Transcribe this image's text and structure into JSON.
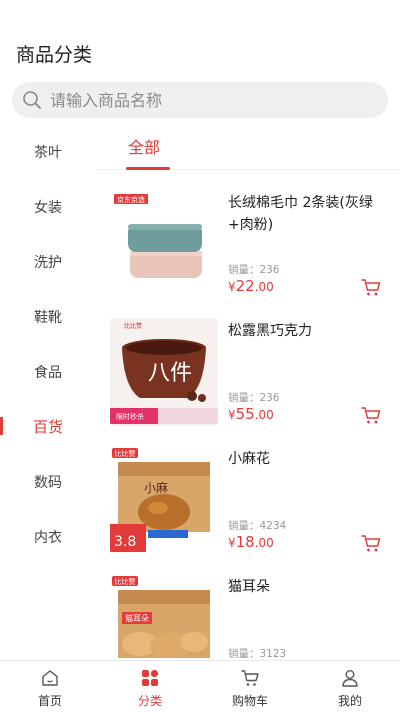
{
  "header": {
    "title": "商品分类"
  },
  "search": {
    "placeholder": "请输入商品名称",
    "icon": "search-icon"
  },
  "sidebar": {
    "items": [
      {
        "label": "茶叶",
        "active": false
      },
      {
        "label": "女装",
        "active": false
      },
      {
        "label": "洗护",
        "active": false
      },
      {
        "label": "鞋靴",
        "active": false
      },
      {
        "label": "食品",
        "active": false
      },
      {
        "label": "百货",
        "active": true
      },
      {
        "label": "数码",
        "active": false
      },
      {
        "label": "内衣",
        "active": false
      }
    ]
  },
  "tabs": {
    "active_label": "全部"
  },
  "products": [
    {
      "name": "长绒棉毛巾 2条装(灰绿+肉粉)",
      "sales": "销量：236",
      "currency": "¥",
      "price_int": "22",
      "price_dec": ".00"
    },
    {
      "name": "松露黑巧克力",
      "sales": "销量：236",
      "currency": "¥",
      "price_int": "55",
      "price_dec": ".00"
    },
    {
      "name": "小麻花",
      "sales": "销量：4234",
      "currency": "¥",
      "price_int": "18",
      "price_dec": ".00"
    },
    {
      "name": "猫耳朵",
      "sales": "销量：3123",
      "currency": "¥",
      "price_int": "",
      "price_dec": ""
    }
  ],
  "product_images": {
    "p0_badge": "京东京造",
    "p1_text": "八件",
    "p1_brand": "比比赞",
    "p1_promo": "限时秒杀",
    "p2_brand": "比比赞",
    "p2_label": "小麻",
    "p2_price": "3.8",
    "p3_brand": "比比赞",
    "p3_label": "猫耳朵"
  },
  "tabbar": {
    "items": [
      {
        "label": "首页",
        "icon": "home-icon",
        "active": false
      },
      {
        "label": "分类",
        "icon": "category-icon",
        "active": true
      },
      {
        "label": "购物车",
        "icon": "cart-icon",
        "active": false
      },
      {
        "label": "我的",
        "icon": "profile-icon",
        "active": false
      }
    ]
  },
  "colors": {
    "accent": "#e33a3a",
    "muted": "#999999",
    "search_bg": "#efefef"
  }
}
